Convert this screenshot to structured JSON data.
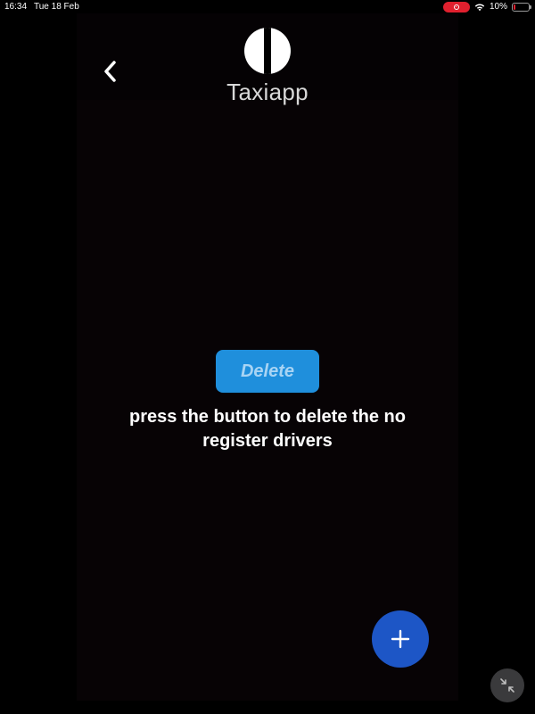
{
  "status_bar": {
    "time": "16:34",
    "date": "Tue 18 Feb",
    "battery_percent": "10%",
    "battery_level": 0.1,
    "recording": true
  },
  "header": {
    "back_icon": "chevron-left-icon",
    "logo_icon": "taxiapp-logo-icon",
    "title": "Taxiapp"
  },
  "main": {
    "delete_label": "Delete",
    "instruction": "press the button to delete the no register drivers"
  },
  "fab": {
    "icon": "plus-icon"
  },
  "overlay": {
    "minimize_icon": "collapse-arrows-icon"
  },
  "colors": {
    "background": "#000000",
    "delete_button": "#1f8fdc",
    "delete_text": "#a8d4f4",
    "fab": "#1d56c6",
    "record_indicator": "#e0202e"
  }
}
